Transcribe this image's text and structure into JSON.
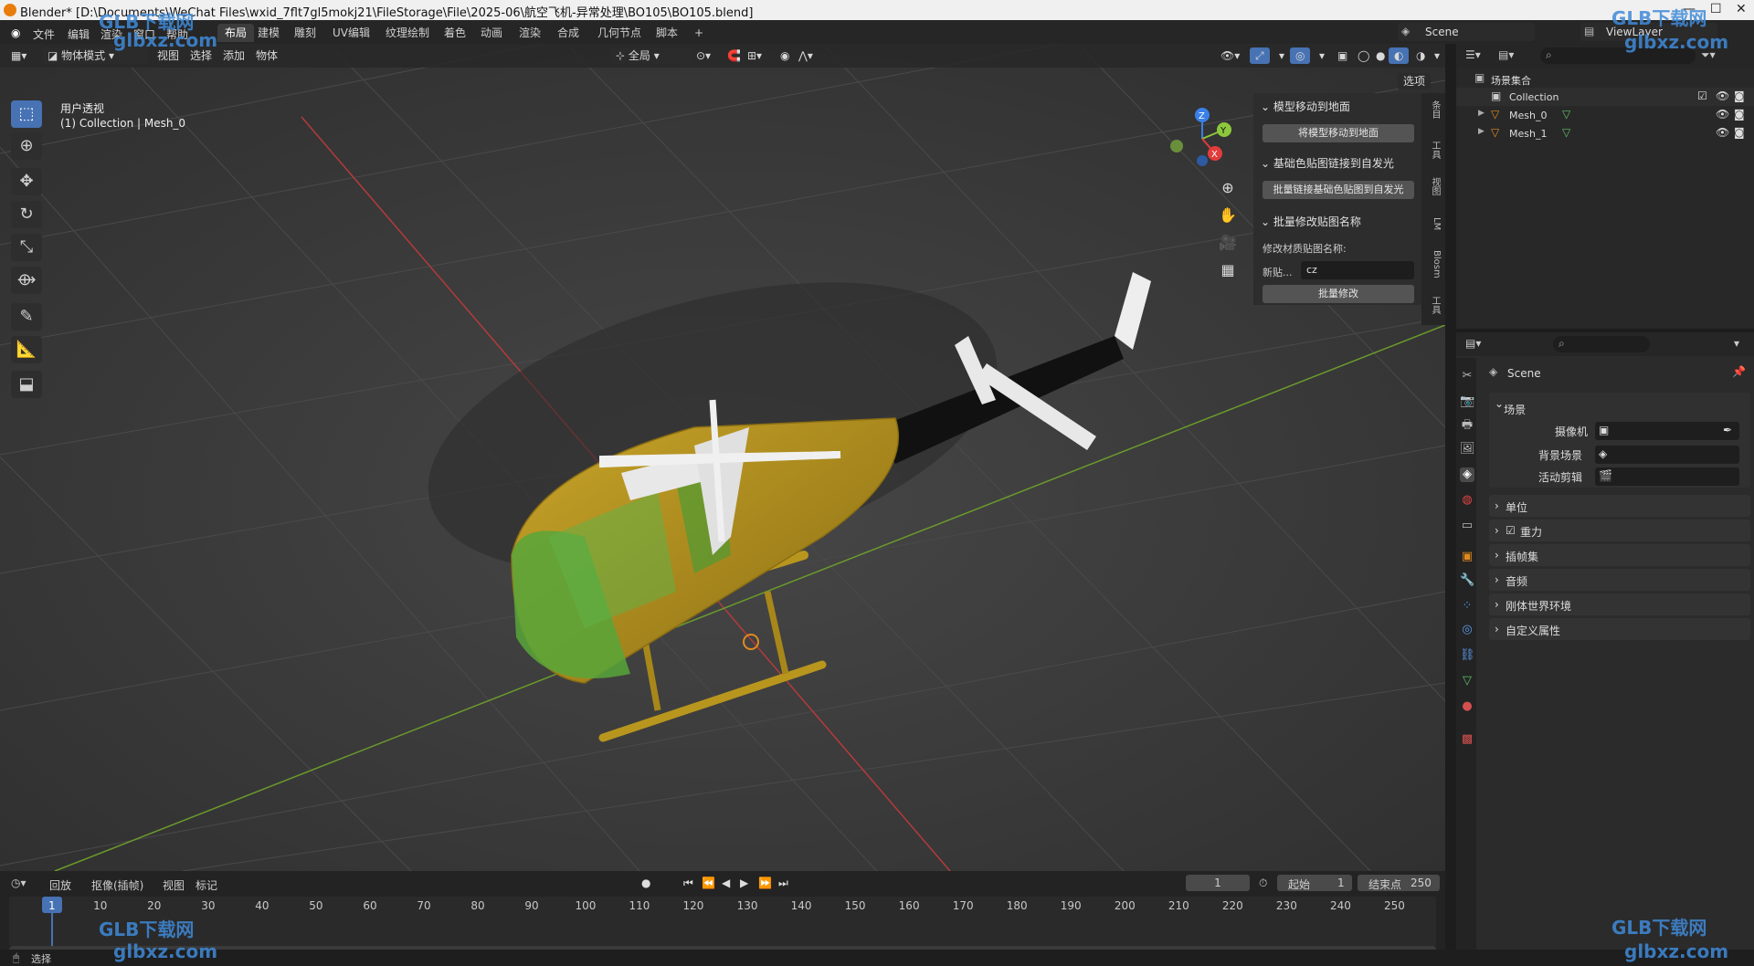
{
  "window": {
    "title": "Blender* [D:\\Documents\\WeChat Files\\wxid_7flt7gl5mokj21\\FileStorage\\File\\2025-06\\航空飞机-异常处理\\BO105\\BO105.blend]",
    "controls": [
      "—",
      "☐",
      "✕"
    ]
  },
  "menubar": {
    "menus": [
      "文件",
      "编辑",
      "渲染",
      "窗口",
      "帮助"
    ],
    "workspaces": [
      "布局",
      "建模",
      "雕刻",
      "UV编辑",
      "纹理绘制",
      "着色",
      "动画",
      "渲染",
      "合成",
      "几何节点",
      "脚本"
    ],
    "active_workspace": "布局",
    "add_tab": "+",
    "scene": "Scene",
    "view_layer": "ViewLayer"
  },
  "viewport_header": {
    "mode": "物体模式",
    "menus": [
      "视图",
      "选择",
      "添加",
      "物体"
    ],
    "transform_orientation": "全局",
    "options": "选项"
  },
  "viewport": {
    "view_name": "用户透视",
    "collection_info": "(1) Collection | Mesh_0",
    "gizmo": {
      "x": "X",
      "y": "Y",
      "z": "Z"
    }
  },
  "npanel": {
    "section1": {
      "title": "模型移动到地面",
      "button": "将模型移动到地面"
    },
    "section2": {
      "title": "基础色贴图链接到自发光",
      "button": "批量链接基础色贴图到自发光"
    },
    "section3": {
      "title": "批量修改贴图名称",
      "label": "修改材质贴图名称:",
      "field_label": "新贴...",
      "field_value": "cz",
      "button": "批量修改"
    },
    "tabs": [
      "条目",
      "工具",
      "视图",
      "LM",
      "Blosm",
      "工具"
    ]
  },
  "outliner": {
    "root": "场景集合",
    "items": [
      {
        "name": "Collection"
      },
      {
        "name": "Mesh_0"
      },
      {
        "name": "Mesh_1"
      }
    ]
  },
  "properties": {
    "scene_name": "Scene",
    "section_scene": "场景",
    "camera_label": "摄像机",
    "bg_scene_label": "背景场景",
    "active_clip_label": "活动剪辑",
    "collapsed_sections": [
      "单位",
      "重力",
      "插帧集",
      "音频",
      "刚体世界环境",
      "自定义属性"
    ]
  },
  "timeline": {
    "menus": [
      "回放",
      "抠像(插帧)",
      "视图",
      "标记"
    ],
    "current_frame": "1",
    "start_label": "起始",
    "start_value": "1",
    "end_label": "结束点",
    "end_value": "250",
    "ticks": [
      "1",
      "10",
      "20",
      "30",
      "40",
      "50",
      "60",
      "70",
      "80",
      "90",
      "100",
      "110",
      "120",
      "130",
      "140",
      "150",
      "160",
      "170",
      "180",
      "190",
      "200",
      "210",
      "220",
      "230",
      "240",
      "250"
    ]
  },
  "statusbar": {
    "left": "选择"
  },
  "watermark": {
    "brand": "GLB下载网",
    "domain": "glbxz.com"
  },
  "colors": {
    "accent": "#4772b3",
    "axis_x": "#e23c3c",
    "axis_y": "#8cc83c",
    "axis_z": "#3a80e8",
    "body": "#b8961e",
    "canopy": "#58a63a"
  }
}
